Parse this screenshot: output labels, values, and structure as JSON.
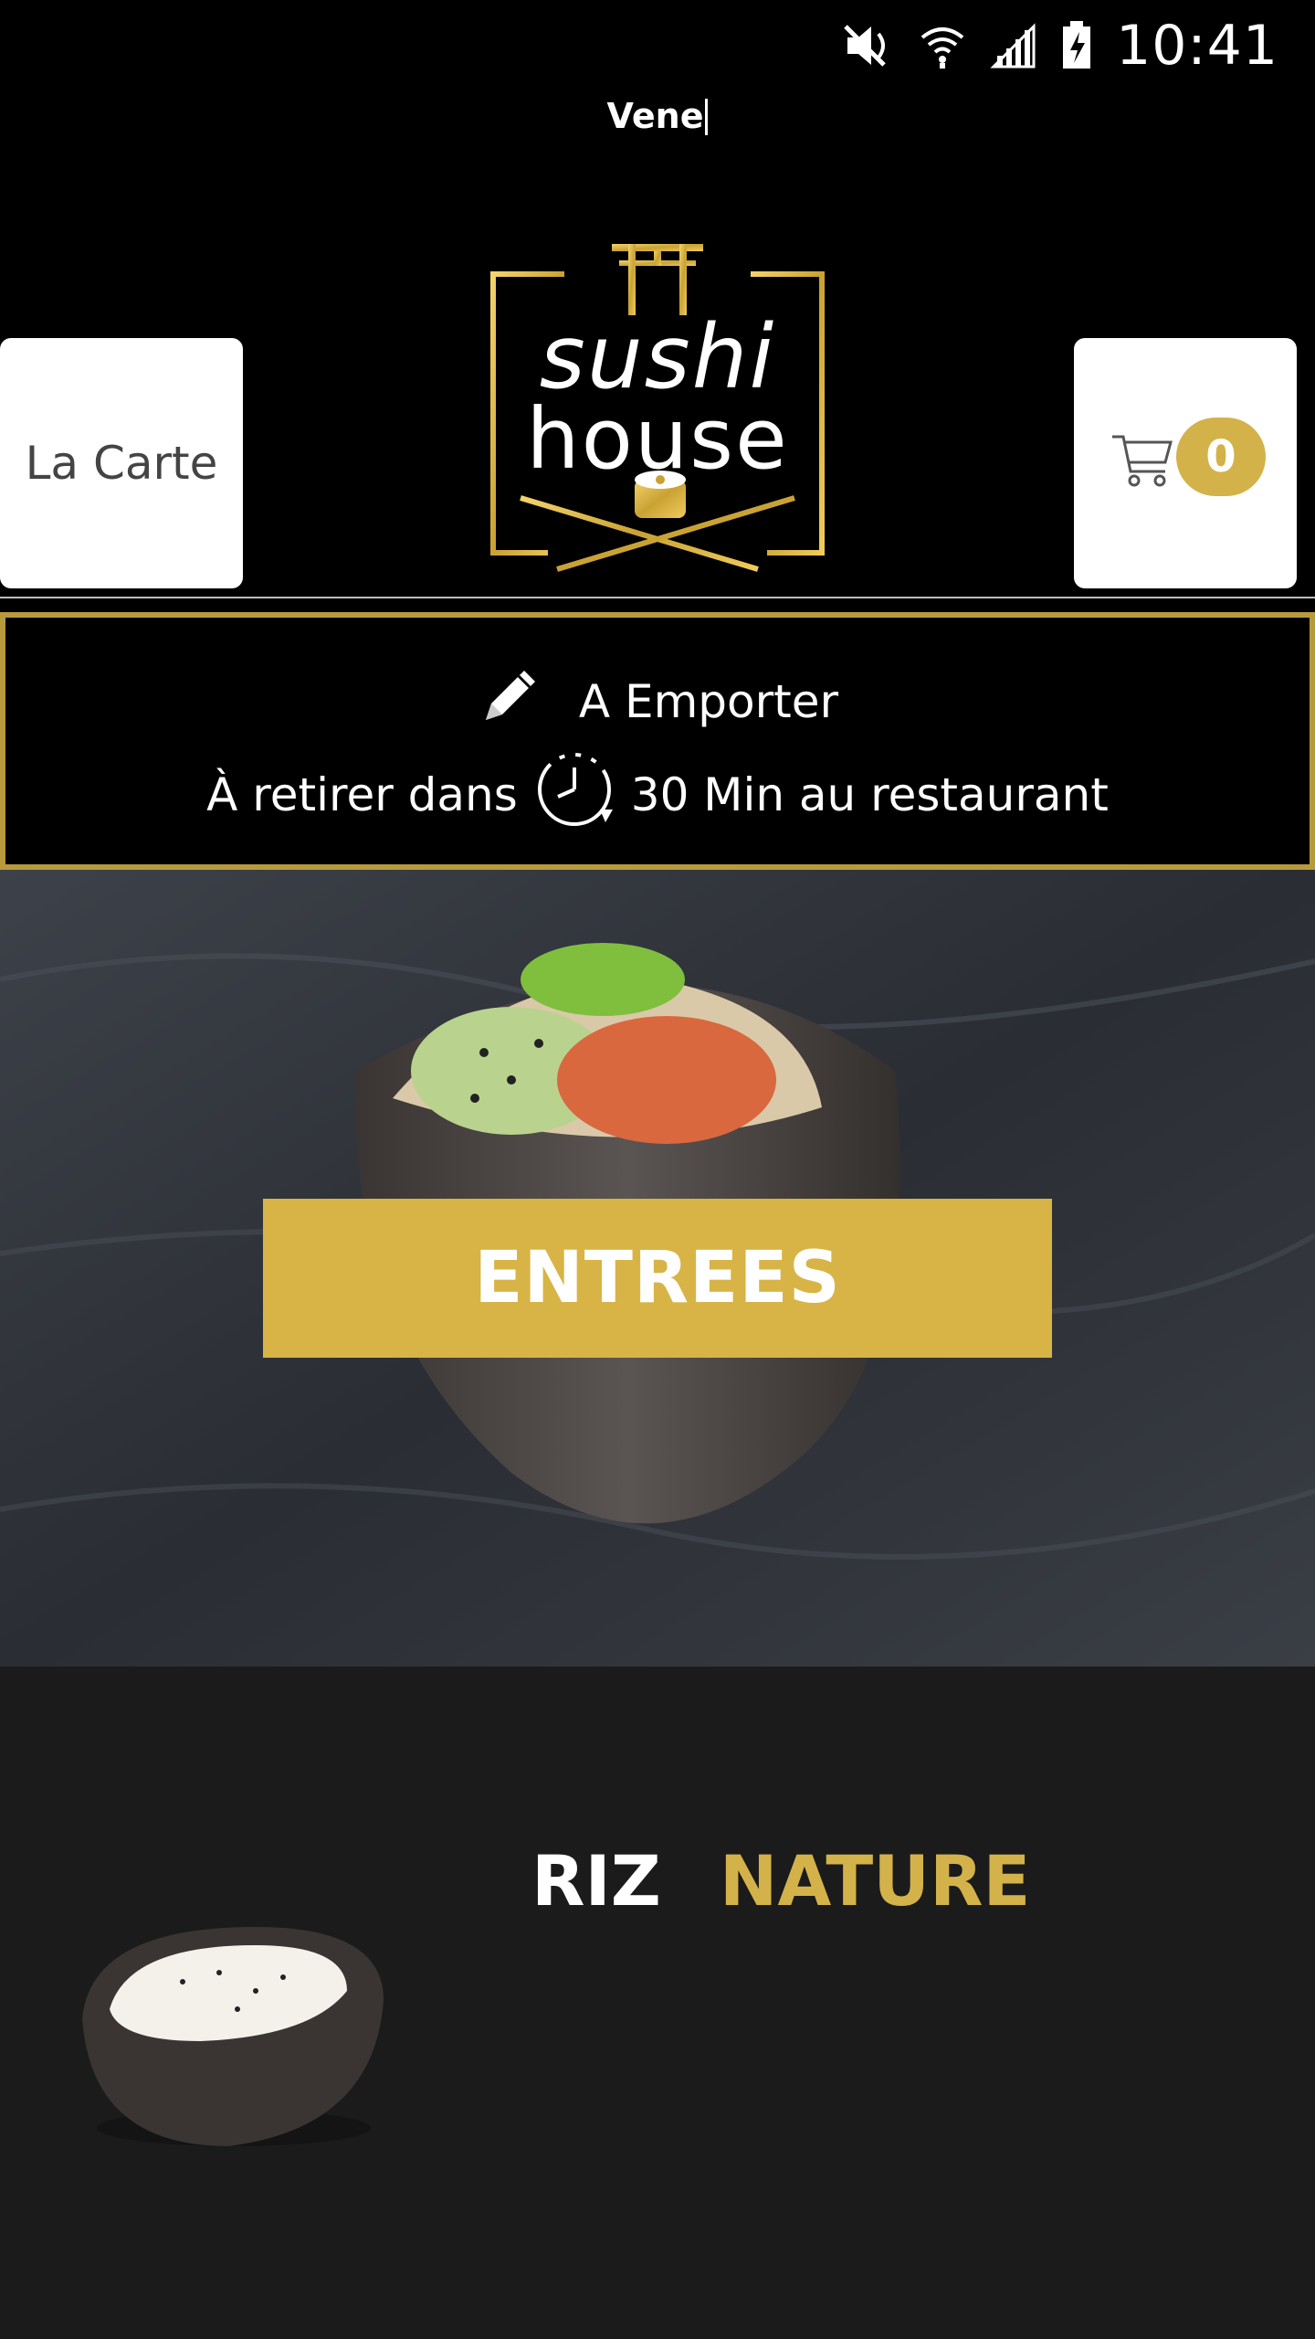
{
  "status_bar": {
    "time": "10:41",
    "icons": [
      "mute-icon",
      "wifi-icon",
      "signal-icon",
      "battery-charging-icon"
    ]
  },
  "header": {
    "address_text": "Vene",
    "menu_button_label": "La Carte",
    "cart_count": "0",
    "logo": {
      "line1": "sushi",
      "line2": "house"
    }
  },
  "order_info": {
    "mode_label": "A Emporter",
    "pickup_prefix": "À retirer dans",
    "pickup_suffix": "30 Min au restaurant",
    "icons": [
      "pencil-icon",
      "clock-icon"
    ]
  },
  "colors": {
    "gold": "#d8b447",
    "gold_border": "#b89a3e",
    "background": "#000000",
    "section_background": "#1b1b1b"
  },
  "hero": {
    "category_label": "ENTREES"
  },
  "product": {
    "title_word1": "RIZ",
    "title_word2": "NATURE"
  }
}
